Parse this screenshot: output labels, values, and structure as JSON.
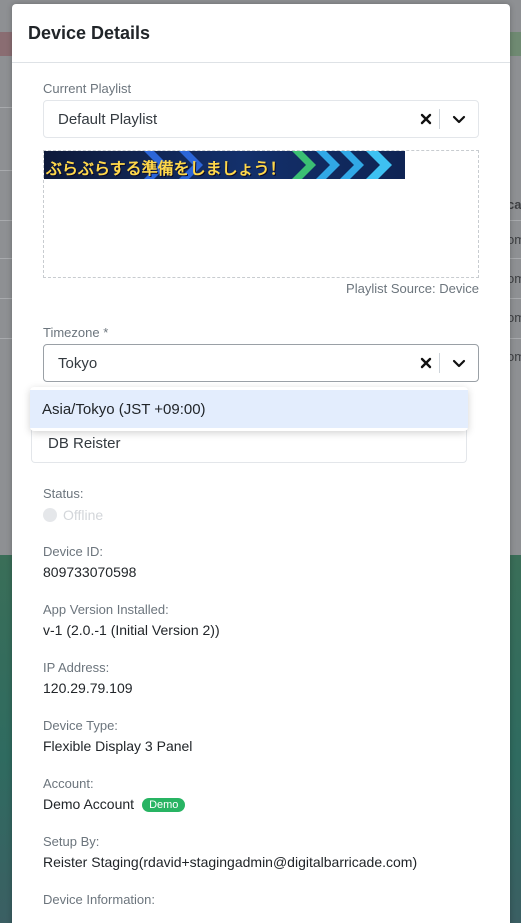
{
  "modal": {
    "title": "Device Details"
  },
  "playlist": {
    "label": "Current Playlist",
    "value": "Default Playlist",
    "banner_text": "ぶらぶらする準備をしましょう！",
    "source": "Playlist Source: Device"
  },
  "timezone": {
    "label": "Timezone *",
    "value": "Tokyo",
    "option": "Asia/Tokyo (JST +09:00)"
  },
  "name_field": {
    "value": "DB Reister"
  },
  "details": {
    "status_label": "Status:",
    "status_value": "Offline",
    "device_id_label": "Device ID:",
    "device_id": "809733070598",
    "app_version_label": "App Version Installed:",
    "app_version": "v-1 (2.0.-1 (Initial Version 2))",
    "ip_label": "IP Address:",
    "ip": "120.29.79.109",
    "device_type_label": "Device Type:",
    "device_type": "Flexible Display 3 Panel",
    "account_label": "Account:",
    "account": "Demo Account",
    "account_badge": "Demo",
    "setup_label": "Setup By:",
    "setup_by": "Reister Staging(rdavid+stagingadmin@digitalbarricade.com)",
    "device_info_label": "Device Information:"
  },
  "background": {
    "fragments": [
      "ca",
      "om",
      "om",
      "om",
      "om"
    ]
  },
  "colors": {
    "badge": "#28b463",
    "highlight": "#e3edfd"
  }
}
